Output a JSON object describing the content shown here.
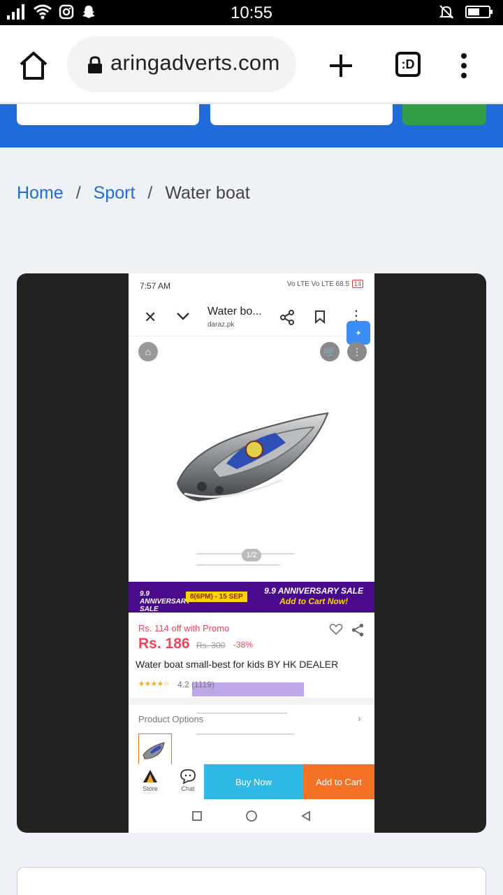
{
  "status_bar": {
    "time": "10:55"
  },
  "browser": {
    "url": "aringadverts.com",
    "tab_count": ":D"
  },
  "breadcrumb": {
    "home": "Home",
    "sep1": "/",
    "category": "Sport",
    "sep2": "/",
    "current": "Water boat"
  },
  "product_screenshot": {
    "status_time": "7:57 AM",
    "status_icons": "Vo LTE Vo LTE 68.5",
    "battery": "14",
    "page_title": "Water bo...",
    "page_domain": "daraz.pk",
    "image_counter": "1/2",
    "promo_left": "9.9 ANNIVERSARY SALE",
    "promo_date": "8(6PM) - 15 SEP",
    "promo_right_1": "9.9 ANNIVERSARY SALE",
    "promo_right_2": "Add to Cart Now!",
    "promo_off": "Rs. 114 off with Promo",
    "price": "Rs. 186",
    "price_old": "Rs. 300",
    "discount": "-38%",
    "product_name": "Water boat small-best for kids BY HK DEALER",
    "stars": "★★★★☆",
    "rating": "4.2 (1119)",
    "product_options": "Product Options",
    "store_label": "Store",
    "chat_label": "Chat",
    "buy_now": "Buy Now",
    "add_to_cart": "Add to Cart"
  }
}
